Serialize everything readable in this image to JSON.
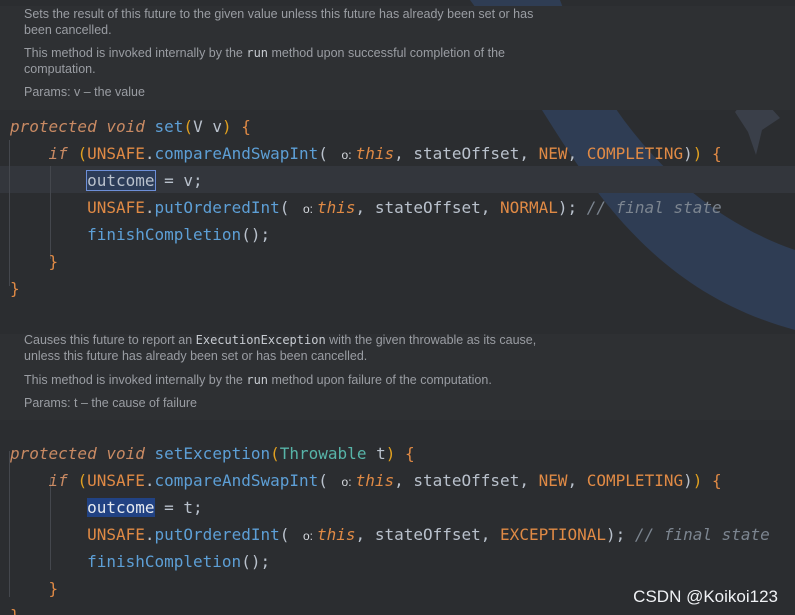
{
  "colors": {
    "background": "#2b2d30",
    "keyword": "#c98a63",
    "method": "#5d9fd6",
    "constant": "#e08a45",
    "type": "#57b4a8",
    "comment": "#7c8590",
    "docs_text": "#9a9da3"
  },
  "docs": [
    {
      "lines": [
        [
          {
            "t": "Sets the result of this future to the given value unless this future has already been set or has"
          }
        ],
        [
          {
            "t": "been cancelled."
          }
        ],
        [
          {
            "t": "This method is invoked internally by the "
          },
          {
            "t": "run",
            "c": "dc"
          },
          {
            "t": " method upon successful completion of the"
          }
        ],
        [
          {
            "t": "computation."
          }
        ],
        [
          {
            "t": "Params: v – the value"
          }
        ]
      ]
    },
    {
      "lines": [
        [
          {
            "t": "Causes this future to report an "
          },
          {
            "t": "ExecutionException",
            "c": "dc"
          },
          {
            "t": " with the given throwable as its cause,"
          }
        ],
        [
          {
            "t": "unless this future has already been set or has been cancelled."
          }
        ],
        [
          {
            "t": "This method is invoked internally by the "
          },
          {
            "t": "run",
            "c": "dc"
          },
          {
            "t": " method upon failure of the computation."
          }
        ],
        [
          {
            "t": "Params: t – the cause of failure"
          }
        ]
      ]
    }
  ],
  "code": [
    [
      [
        {
          "t": "protected",
          "c": "kw"
        },
        {
          "t": " "
        },
        {
          "t": "void",
          "c": "kw"
        },
        {
          "t": " "
        },
        {
          "t": "set",
          "c": "fn"
        },
        {
          "t": "(",
          "c": "paren"
        },
        {
          "t": "V v"
        },
        {
          "t": ")",
          "c": "paren"
        },
        {
          "t": " "
        },
        {
          "t": "{",
          "c": "brace"
        }
      ],
      [
        {
          "t": "    "
        },
        {
          "t": "if",
          "c": "kw"
        },
        {
          "t": " "
        },
        {
          "t": "(",
          "c": "paren"
        },
        {
          "t": "UNSAFE",
          "c": "const"
        },
        {
          "t": "."
        },
        {
          "t": "compareAndSwapInt",
          "c": "fn"
        },
        {
          "t": "( "
        },
        {
          "t": "o:",
          "c": "hint"
        },
        {
          "t": "this",
          "c": "this"
        },
        {
          "t": ", stateOffset, "
        },
        {
          "t": "NEW",
          "c": "const"
        },
        {
          "t": ", "
        },
        {
          "t": "COMPLETING",
          "c": "const"
        },
        {
          "t": ")"
        },
        {
          "t": ")",
          "c": "paren"
        },
        {
          "t": " "
        },
        {
          "t": "{",
          "c": "brace"
        }
      ],
      [
        {
          "t": "        "
        },
        {
          "t": "outcome",
          "c": "sel-box"
        },
        {
          "t": " = v;"
        }
      ],
      [
        {
          "t": "        "
        },
        {
          "t": "UNSAFE",
          "c": "const"
        },
        {
          "t": "."
        },
        {
          "t": "putOrderedInt",
          "c": "fn"
        },
        {
          "t": "( "
        },
        {
          "t": "o:",
          "c": "hint"
        },
        {
          "t": "this",
          "c": "this"
        },
        {
          "t": ", stateOffset, "
        },
        {
          "t": "NORMAL",
          "c": "const"
        },
        {
          "t": "); "
        },
        {
          "t": "// final state",
          "c": "cmt"
        }
      ],
      [
        {
          "t": "        "
        },
        {
          "t": "finishCompletion",
          "c": "fn"
        },
        {
          "t": "();"
        }
      ],
      [
        {
          "t": "    "
        },
        {
          "t": "}",
          "c": "brace"
        }
      ],
      [
        {
          "t": "}",
          "c": "brace"
        }
      ]
    ],
    [
      [
        {
          "t": "protected",
          "c": "kw"
        },
        {
          "t": " "
        },
        {
          "t": "void",
          "c": "kw"
        },
        {
          "t": " "
        },
        {
          "t": "setException",
          "c": "fn"
        },
        {
          "t": "(",
          "c": "paren"
        },
        {
          "t": "Throwable",
          "c": "typ"
        },
        {
          "t": " t"
        },
        {
          "t": ")",
          "c": "paren"
        },
        {
          "t": " "
        },
        {
          "t": "{",
          "c": "brace"
        }
      ],
      [
        {
          "t": "    "
        },
        {
          "t": "if",
          "c": "kw"
        },
        {
          "t": " "
        },
        {
          "t": "(",
          "c": "paren"
        },
        {
          "t": "UNSAFE",
          "c": "const"
        },
        {
          "t": "."
        },
        {
          "t": "compareAndSwapInt",
          "c": "fn"
        },
        {
          "t": "( "
        },
        {
          "t": "o:",
          "c": "hint"
        },
        {
          "t": "this",
          "c": "this"
        },
        {
          "t": ", stateOffset, "
        },
        {
          "t": "NEW",
          "c": "const"
        },
        {
          "t": ", "
        },
        {
          "t": "COMPLETING",
          "c": "const"
        },
        {
          "t": ")"
        },
        {
          "t": ")",
          "c": "paren"
        },
        {
          "t": " "
        },
        {
          "t": "{",
          "c": "brace"
        }
      ],
      [
        {
          "t": "        "
        },
        {
          "t": "outcome",
          "c": "sel-fill"
        },
        {
          "t": " = t;"
        }
      ],
      [
        {
          "t": "        "
        },
        {
          "t": "UNSAFE",
          "c": "const"
        },
        {
          "t": "."
        },
        {
          "t": "putOrderedInt",
          "c": "fn"
        },
        {
          "t": "( "
        },
        {
          "t": "o:",
          "c": "hint"
        },
        {
          "t": "this",
          "c": "this"
        },
        {
          "t": ", stateOffset, "
        },
        {
          "t": "EXCEPTIONAL",
          "c": "const"
        },
        {
          "t": "); "
        },
        {
          "t": "// final state",
          "c": "cmt"
        }
      ],
      [
        {
          "t": "        "
        },
        {
          "t": "finishCompletion",
          "c": "fn"
        },
        {
          "t": "();"
        }
      ],
      [
        {
          "t": "    "
        },
        {
          "t": "}",
          "c": "brace"
        }
      ],
      [
        {
          "t": "}",
          "c": "brace"
        }
      ]
    ]
  ],
  "watermark": "CSDN @Koikoi123"
}
